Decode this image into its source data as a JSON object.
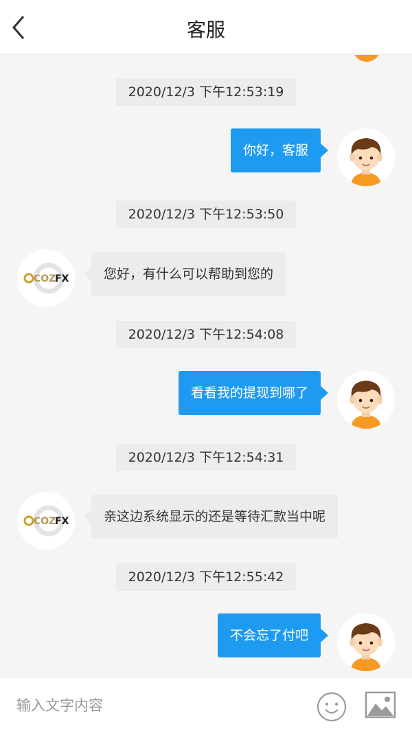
{
  "header": {
    "title": "客服",
    "back_icon": "chevron-left-icon"
  },
  "messages": [
    {
      "time": "2020/12/3 下午12:53:19",
      "sender": "me",
      "text": "你好，客服"
    },
    {
      "time": "2020/12/3 下午12:53:50",
      "sender": "agent",
      "text": "您好，有什么可以帮助到您的"
    },
    {
      "time": "2020/12/3 下午12:54:08",
      "sender": "me",
      "text": "看看我的提现到哪了"
    },
    {
      "time": "2020/12/3 下午12:54:31",
      "sender": "agent",
      "text": "亲这边系统显示的还是等待汇款当中呢"
    },
    {
      "time": "2020/12/3 下午12:55:42",
      "sender": "me",
      "text": "不会忘了付吧"
    }
  ],
  "agent_logo": {
    "brand_text": "COZFX",
    "colors": {
      "cozfx": "#b39a5c",
      "fx": "#1a1a1a"
    }
  },
  "input_bar": {
    "placeholder": "输入文字内容",
    "emoji_icon": "smiley-icon",
    "image_icon": "image-icon"
  },
  "colors": {
    "my_bubble": "#1e9bf0",
    "agent_bubble": "#ececec",
    "background": "#f5f5f5",
    "avatar_shirt": "#f59a23"
  }
}
